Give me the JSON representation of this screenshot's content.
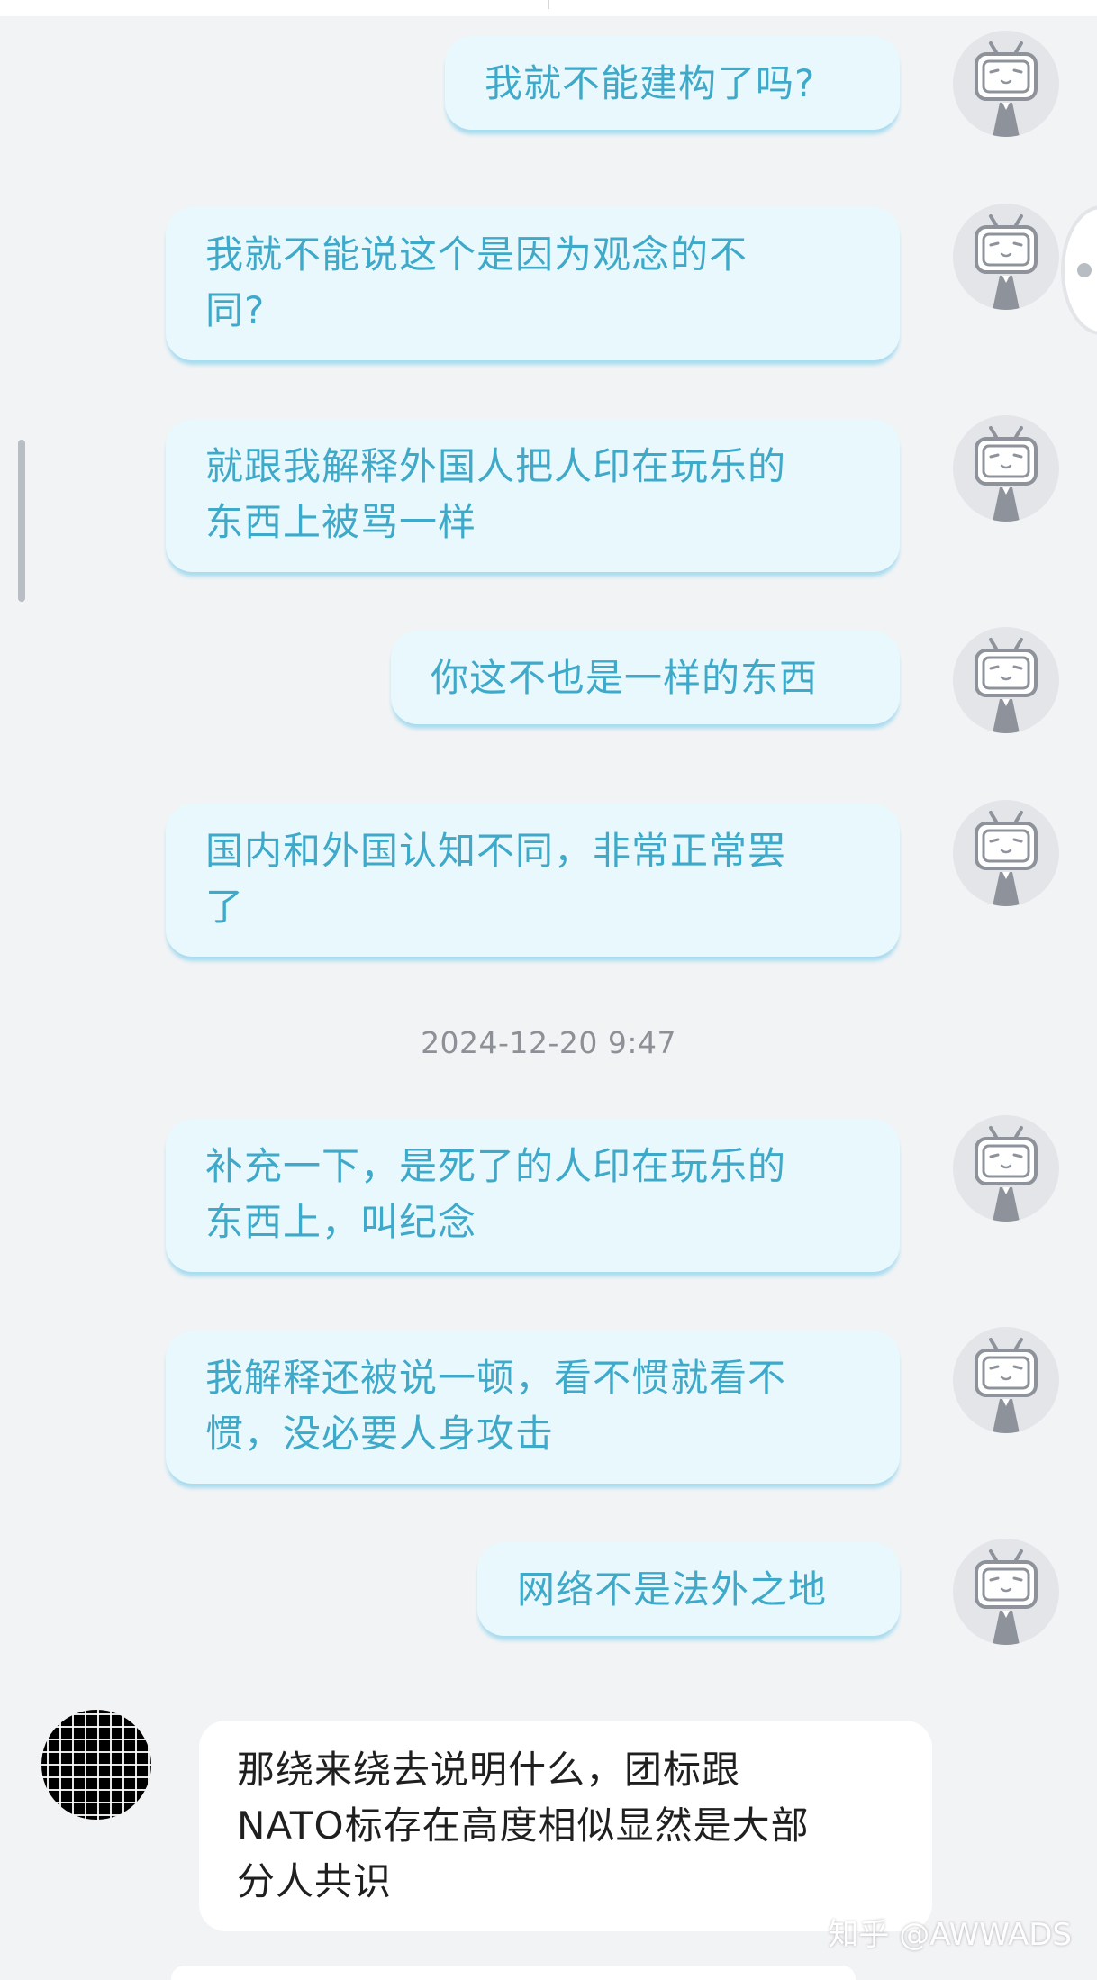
{
  "conversation": {
    "messages_before": [
      "我就不能建构了吗?",
      "我就不能说这个是因为观念的不\n同?",
      "就跟我解释外国人把人印在玩乐的\n东西上被骂一样",
      "你这不也是一样的东西",
      "国内和外国认知不同，非常正常罢\n了"
    ],
    "timestamp": "2024-12-20 9:47",
    "messages_after": [
      "补充一下，是死了的人印在玩乐的\n东西上，叫纪念",
      "我解释还被说一顿，看不惯就看不\n惯，没必要人身攻击",
      "网络不是法外之地"
    ],
    "reply": "那绕来绕去说明什么，团标跟\nNATO标存在高度相似显然是大部\n分人共识"
  },
  "watermark": "知乎 @AWWADS",
  "colors": {
    "background": "#f2f3f5",
    "my_bubble": "#e9f8fd",
    "my_text": "#3ea9c9",
    "other_bubble": "#ffffff",
    "other_text": "#1f1f1f",
    "timestamp": "#8d9097"
  },
  "icons": {
    "my_avatar": "tv-mascot-icon",
    "other_avatar": "grid-avatar-icon"
  }
}
